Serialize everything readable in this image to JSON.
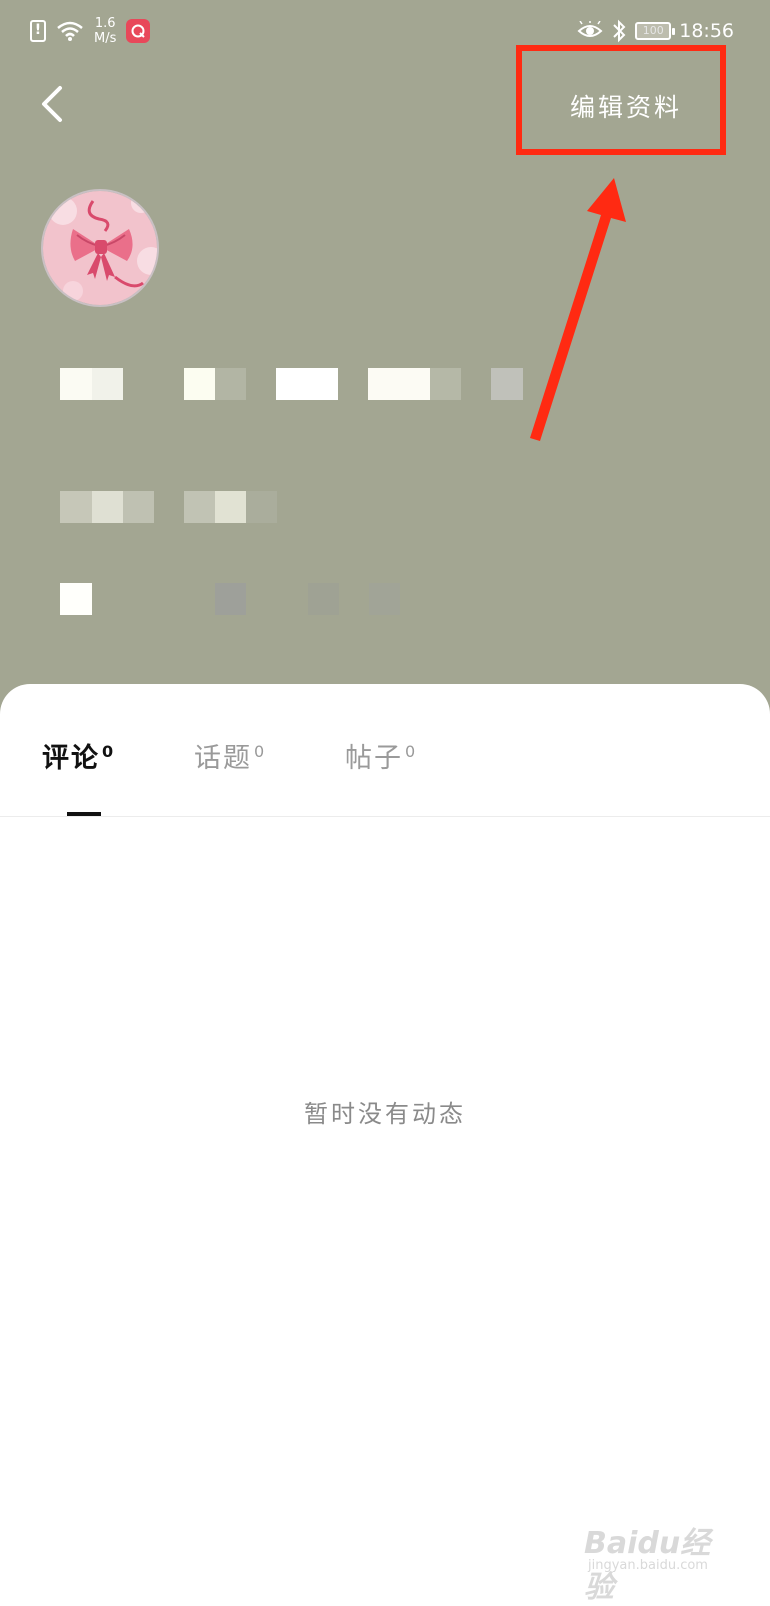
{
  "status_bar": {
    "net_speed_value": "1.6",
    "net_speed_unit": "M/s",
    "battery": "100",
    "time": "18:56",
    "icons": [
      "sim-alert-icon",
      "wifi-icon",
      "app-badge-icon",
      "eye-icon",
      "bluetooth-icon",
      "battery-icon"
    ]
  },
  "nav": {
    "back_icon": "chevron-left-icon",
    "edit_profile_label": "编辑资料"
  },
  "annotation": {
    "highlight_color": "#ff2a12"
  },
  "colors": {
    "header_bg": "#a3a692",
    "card_bg": "#ffffff",
    "active_tab": "#111111",
    "inactive_tab": "#9a9a9a"
  },
  "tabs": [
    {
      "label": "评论",
      "count": "0",
      "active": true
    },
    {
      "label": "话题",
      "count": "0",
      "active": false
    },
    {
      "label": "帖子",
      "count": "0",
      "active": false
    }
  ],
  "empty_state": "暂时没有动态",
  "watermark": {
    "main": "Baidu经验",
    "sub": "jingyan.baidu.com"
  }
}
